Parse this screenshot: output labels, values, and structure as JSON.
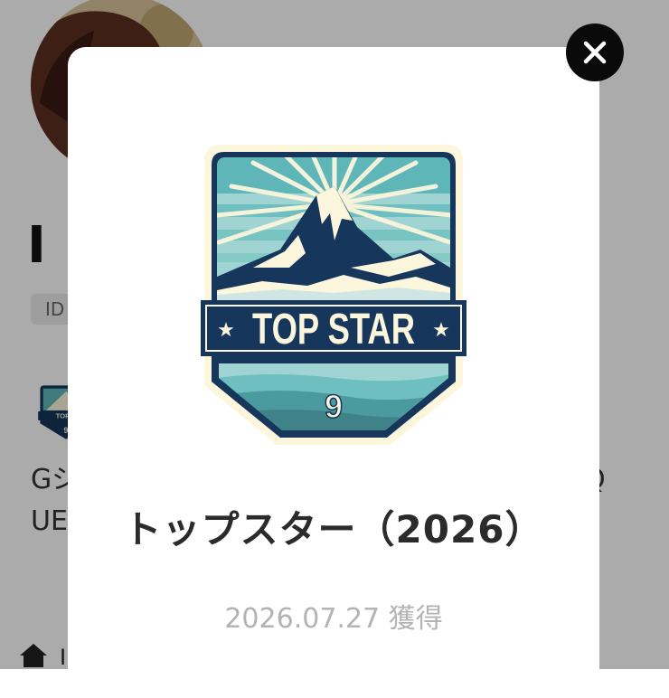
{
  "background": {
    "username_visible": "I (",
    "id_label": "ID",
    "bio_line1": "Gジ",
    "bio_line2": "UE",
    "bio_line1_end": "Q",
    "home_label": "I"
  },
  "modal": {
    "badge": {
      "banner_text": "TOP STAR",
      "number": "9"
    },
    "title": "トップスター（2026）",
    "acquired_date": "2026.07.27 獲得"
  },
  "colors": {
    "overlay": "#000000",
    "badge_navy": "#16365c",
    "badge_teal": "#5fb6b9",
    "badge_cream": "#fbf6dc",
    "close_button": "#0a0a0a"
  },
  "icons": {
    "close": "close-icon",
    "home": "home-icon"
  }
}
